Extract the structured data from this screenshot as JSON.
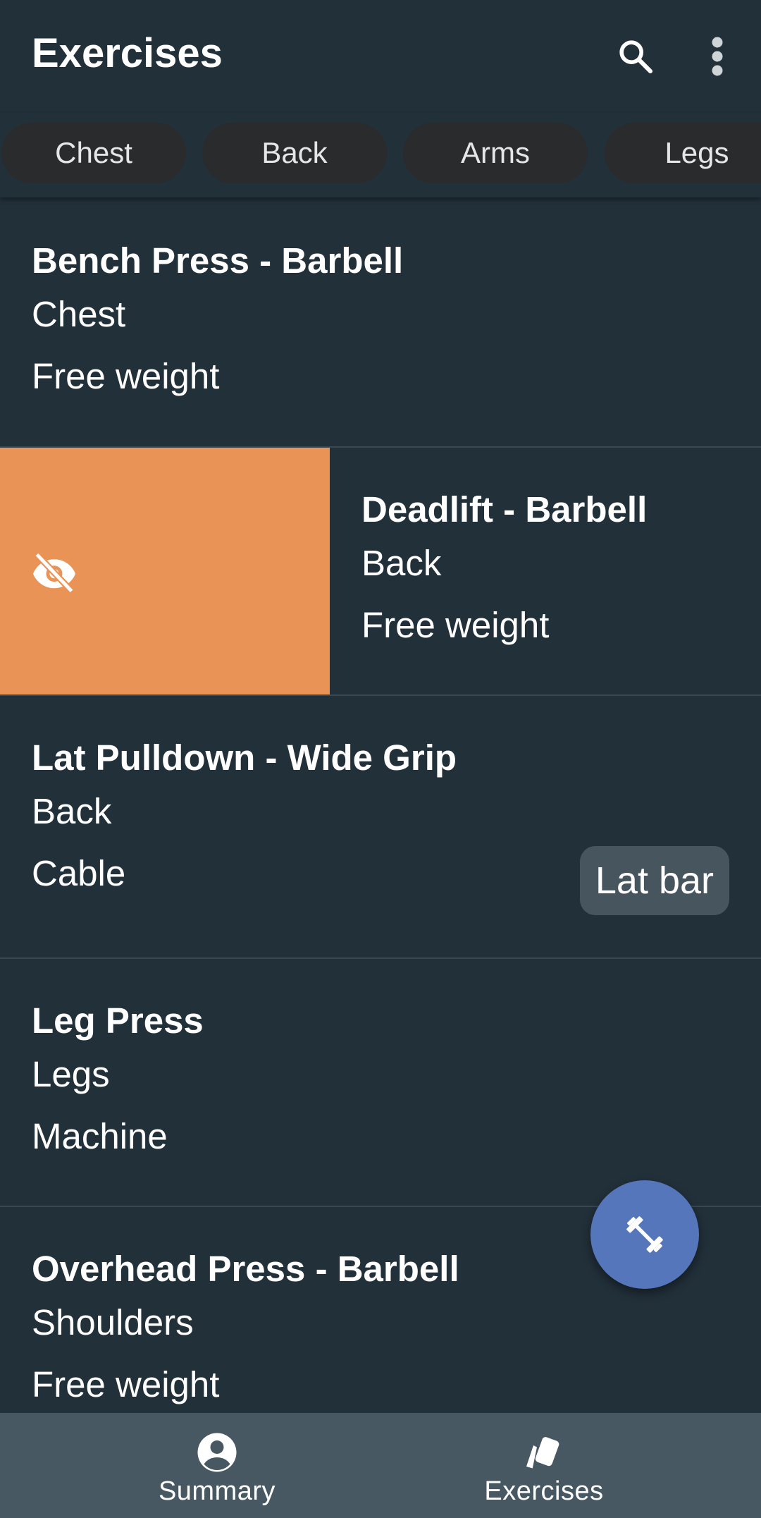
{
  "appbar": {
    "title": "Exercises",
    "search_icon": "search-icon",
    "more_icon": "more-vert-icon"
  },
  "chips": [
    "Chest",
    "Back",
    "Arms",
    "Legs"
  ],
  "exercises": [
    {
      "name": "Bench Press - Barbell",
      "muscle": "Chest",
      "type": "Free weight",
      "tag": ""
    },
    {
      "name": "Deadlift - Barbell",
      "muscle": "Back",
      "type": "Free weight",
      "tag": "",
      "swipe_action_icon": "visibility-off-icon"
    },
    {
      "name": "Lat Pulldown - Wide Grip",
      "muscle": "Back",
      "type": "Cable",
      "tag": "Lat bar"
    },
    {
      "name": "Leg Press",
      "muscle": "Legs",
      "type": "Machine",
      "tag": ""
    },
    {
      "name": "Overhead Press - Barbell",
      "muscle": "Shoulders",
      "type": "Free weight",
      "tag": ""
    }
  ],
  "fab": {
    "icon": "dumbbell-icon"
  },
  "bottom_nav": [
    {
      "label": "Summary",
      "icon": "account-circle-icon"
    },
    {
      "label": "Exercises",
      "icon": "cards-icon"
    }
  ],
  "colors": {
    "background": "#22303a",
    "swipe_action": "#e99456",
    "fab": "#5676bb",
    "bottom_nav": "#475863",
    "chip": "#2a2b2c",
    "tag": "#47555f"
  }
}
